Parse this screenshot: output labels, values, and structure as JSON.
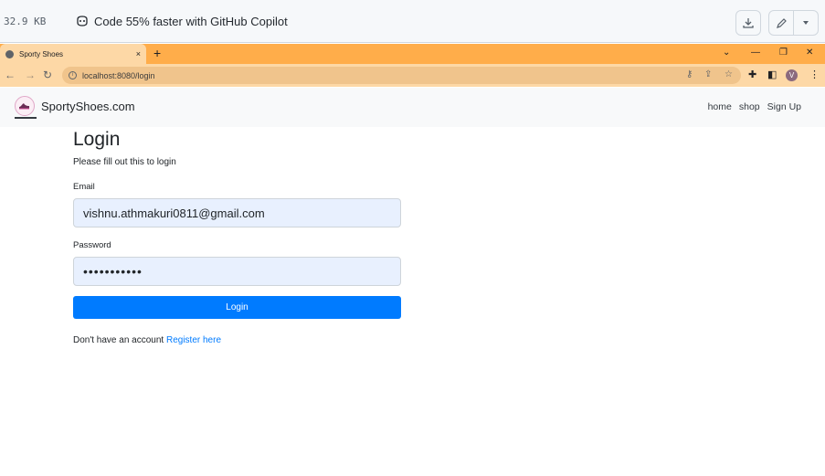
{
  "github": {
    "file_size": "32.9 KB",
    "copilot_text": "Code 55% faster with GitHub Copilot"
  },
  "browser": {
    "tab_title": "Sporty Shoes",
    "tab_close": "×",
    "new_tab": "+",
    "url": "localhost:8080/login",
    "profile_initial": "V"
  },
  "navbar": {
    "brand": "SportyShoes.com",
    "links": [
      "home",
      "shop",
      "Sign Up"
    ]
  },
  "login": {
    "title": "Login",
    "subtitle": "Please fill out this to login",
    "email_label": "Email",
    "email_value": "vishnu.athmakuri0811@gmail.com",
    "password_label": "Password",
    "password_value": "•••••••••••",
    "button_label": "Login",
    "no_account_text": "Don't have an account",
    "register_link": "Register here"
  },
  "colors": {
    "tab_strip": "#ffad4a",
    "address_bar": "#fdd8a6",
    "primary": "#007bff",
    "input_autofill": "#e8f0fe"
  }
}
